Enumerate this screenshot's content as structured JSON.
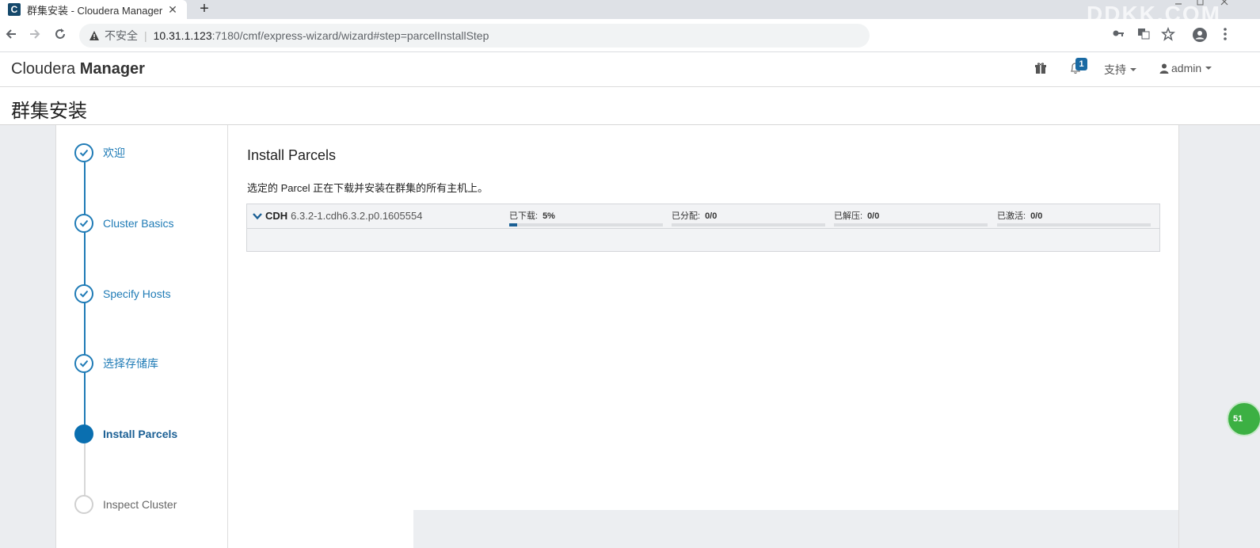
{
  "browser": {
    "tab_title": "群集安装 - Cloudera Manager",
    "tab_favicon_letter": "C",
    "tab_close": "✕",
    "new_tab": "+",
    "insecure_label": "不安全",
    "url_host": "10.31.1.123",
    "url_path": ":7180/cmf/express-wizard/wizard#step=parcelInstallStep",
    "watermark": "DDKK.COM"
  },
  "header": {
    "logo_plain": "Cloudera ",
    "logo_bold": "Manager",
    "notification_count": "1",
    "support_label": "支持",
    "user_label": "admin"
  },
  "page": {
    "title": "群集安装"
  },
  "wizard": {
    "steps": [
      {
        "label": "欢迎",
        "state": "done"
      },
      {
        "label": "Cluster Basics",
        "state": "done"
      },
      {
        "label": "Specify Hosts",
        "state": "done"
      },
      {
        "label": "选择存储库",
        "state": "done"
      },
      {
        "label": "Install Parcels",
        "state": "active"
      },
      {
        "label": "Inspect Cluster",
        "state": "pending"
      }
    ]
  },
  "main": {
    "title": "Install Parcels",
    "description": "选定的 Parcel 正在下载并安装在群集的所有主机上。",
    "parcel": {
      "name": "CDH",
      "version": "6.3.2-1.cdh6.3.2.p0.1605554",
      "downloaded_label": "已下载:",
      "downloaded_value": "5%",
      "downloaded_progress": 0.05,
      "distributed_label": "已分配:",
      "distributed_value": "0/0",
      "unpacked_label": "已解压:",
      "unpacked_value": "0/0",
      "activated_label": "已激活:",
      "activated_value": "0/0"
    }
  },
  "float_badge": "51",
  "colors": {
    "accent": "#1f7bb6",
    "active_step": "#0a6fb0",
    "progress": "#1a5f94"
  }
}
